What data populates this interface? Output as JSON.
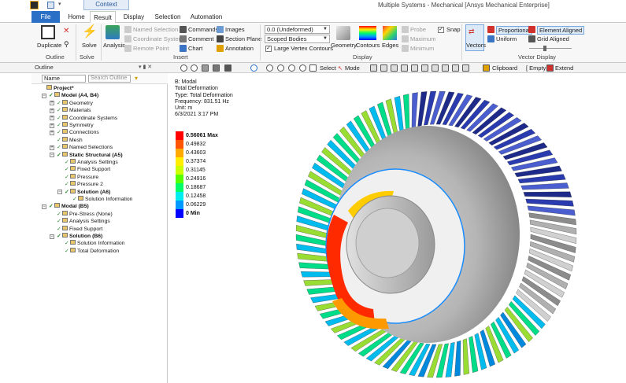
{
  "window": {
    "title": "Multiple Systems - Mechanical [Ansys Mechanical Enterprise]",
    "context_tab": "Context"
  },
  "tabs": [
    "File",
    "Home",
    "Result",
    "Display",
    "Selection",
    "Automation"
  ],
  "ribbon": {
    "outline": {
      "duplicate": "Duplicate",
      "group": "Outline"
    },
    "solve": {
      "solve": "Solve",
      "group": "Solve"
    },
    "insert": {
      "analysis": "Analysis",
      "named_selection": "Named Selection",
      "coordinate_system": "Coordinate System",
      "remote_point": "Remote Point",
      "commands": "Commands",
      "comment": "Comment",
      "chart": "Chart",
      "images": "Images",
      "section_plane": "Section Plane",
      "annotation": "Annotation",
      "group": "Insert"
    },
    "display": {
      "scale": "0.0 (Undeformed)",
      "scoped": "Scoped Bodies",
      "large_vertex": "Large Vertex Contours",
      "geometry": "Geometry",
      "contours": "Contours",
      "edges": "Edges",
      "probe": "Probe",
      "maximum": "Maximum",
      "minimum": "Minimum",
      "snap": "Snap",
      "group": "Display"
    },
    "vector": {
      "vectors": "Vectors",
      "proportional": "Proportional",
      "uniform": "Uniform",
      "element_aligned": "Element Aligned",
      "grid_aligned": "Grid Aligned",
      "group": "Vector Display"
    }
  },
  "toolbar": {
    "outline_label": "Outline",
    "outline_controls": "▾ ▮ ✕",
    "select": "Select",
    "mode": "Mode",
    "clipboard": "Clipboard",
    "empty": "[ Empty ]",
    "extend": "Extend"
  },
  "outline": {
    "name_filter": "Name",
    "search_placeholder": "Search Outline",
    "tree": [
      {
        "label": "Project*",
        "level": 0,
        "bold": true,
        "exp": ""
      },
      {
        "label": "Model (A4, B4)",
        "level": 1,
        "bold": true,
        "exp": "−"
      },
      {
        "label": "Geometry",
        "level": 2,
        "bold": false,
        "exp": "+"
      },
      {
        "label": "Materials",
        "level": 2,
        "bold": false,
        "exp": "+"
      },
      {
        "label": "Coordinate Systems",
        "level": 2,
        "bold": false,
        "exp": "+"
      },
      {
        "label": "Symmetry",
        "level": 2,
        "bold": false,
        "exp": "+"
      },
      {
        "label": "Connections",
        "level": 2,
        "bold": false,
        "exp": "+"
      },
      {
        "label": "Mesh",
        "level": 2,
        "bold": false,
        "exp": ""
      },
      {
        "label": "Named Selections",
        "level": 2,
        "bold": false,
        "exp": "+"
      },
      {
        "label": "Static Structural (A5)",
        "level": 2,
        "bold": true,
        "exp": "−"
      },
      {
        "label": "Analysis Settings",
        "level": 3,
        "bold": false,
        "exp": ""
      },
      {
        "label": "Fixed Support",
        "level": 3,
        "bold": false,
        "exp": ""
      },
      {
        "label": "Pressure",
        "level": 3,
        "bold": false,
        "exp": ""
      },
      {
        "label": "Pressure 2",
        "level": 3,
        "bold": false,
        "exp": ""
      },
      {
        "label": "Solution (A6)",
        "level": 3,
        "bold": true,
        "exp": "−"
      },
      {
        "label": "Solution Information",
        "level": 4,
        "bold": false,
        "exp": ""
      },
      {
        "label": "Modal (B5)",
        "level": 1,
        "bold": true,
        "exp": "−"
      },
      {
        "label": "Pre-Stress (None)",
        "level": 2,
        "bold": false,
        "exp": ""
      },
      {
        "label": "Analysis Settings",
        "level": 2,
        "bold": false,
        "exp": ""
      },
      {
        "label": "Fixed Support",
        "level": 2,
        "bold": false,
        "exp": ""
      },
      {
        "label": "Solution (B6)",
        "level": 2,
        "bold": true,
        "exp": "−"
      },
      {
        "label": "Solution Information",
        "level": 3,
        "bold": false,
        "exp": ""
      },
      {
        "label": "Total Deformation",
        "level": 3,
        "bold": false,
        "exp": ""
      }
    ]
  },
  "result_info": {
    "system": "B: Modal",
    "name": "Total Deformation",
    "type": "Type: Total Deformation",
    "frequency": "Frequency: 831.51 Hz",
    "unit": "Unit: m",
    "date": "6/3/2021 3:17 PM"
  },
  "legend": [
    {
      "label": "0.56061 Max",
      "color": "#ff0000",
      "bold": true
    },
    {
      "label": "0.49832",
      "color": "#ff5500",
      "bold": false
    },
    {
      "label": "0.43603",
      "color": "#ffaa00",
      "bold": false
    },
    {
      "label": "0.37374",
      "color": "#ffee00",
      "bold": false
    },
    {
      "label": "0.31145",
      "color": "#ccff00",
      "bold": false
    },
    {
      "label": "0.24916",
      "color": "#55ff00",
      "bold": false
    },
    {
      "label": "0.18687",
      "color": "#00ff66",
      "bold": false
    },
    {
      "label": "0.12458",
      "color": "#00eeee",
      "bold": false
    },
    {
      "label": "0.06229",
      "color": "#0099ff",
      "bold": false
    },
    {
      "label": "0 Min",
      "color": "#0000ff",
      "bold": true
    }
  ]
}
